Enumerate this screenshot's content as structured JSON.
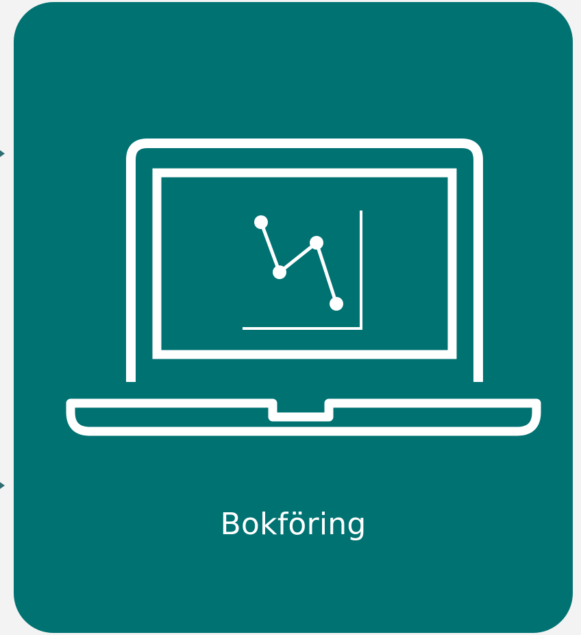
{
  "card": {
    "label": "Bokföring",
    "icon": "laptop-chart-icon"
  },
  "colors": {
    "background": "#f3f3f3",
    "card": "#007272",
    "foreground": "#ffffff",
    "edge_arrow": "#2e6e73"
  },
  "edge_arrows": {
    "top_icon": "arrow-right-icon",
    "bottom_icon": "arrow-right-icon"
  }
}
